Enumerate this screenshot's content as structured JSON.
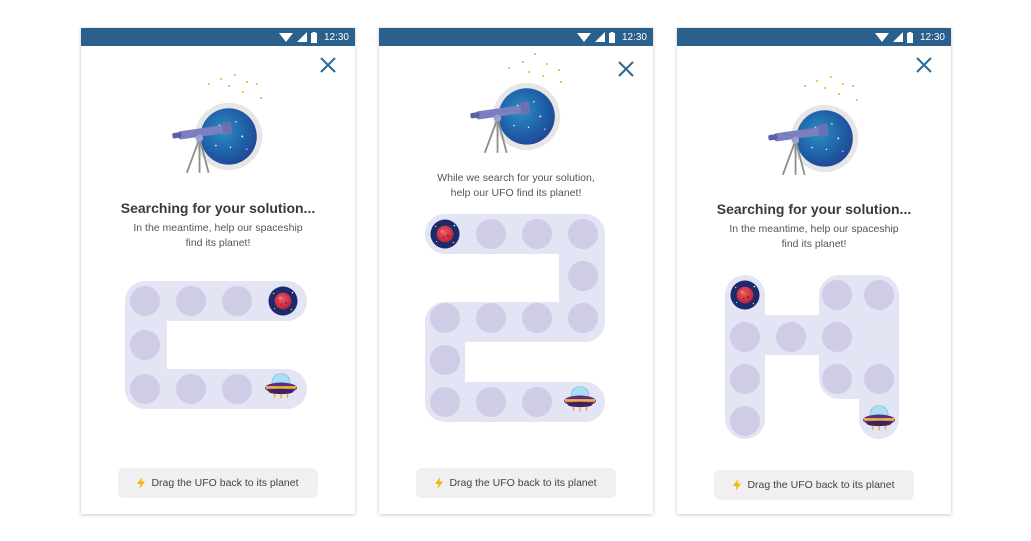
{
  "colors": {
    "status_bar": "#2b5f8c",
    "close_icon": "#2b6b96",
    "path_bg": "#e3e4f4",
    "cell": "#cfcde6",
    "hint_bg": "#f0f0f3",
    "bolt": "#f7b500",
    "planet_red": "#d7384a",
    "space_blue": "#1f5fa8"
  },
  "screens": [
    {
      "status_time": "12:30",
      "title": "Searching for your solution...",
      "subtitle_lines": [
        "In the meantime, help our spaceship",
        "find its planet!"
      ],
      "hint_label": "Drag the UFO back to its planet"
    },
    {
      "status_time": "12:30",
      "title": "",
      "subtitle_lines": [
        "While we search for your solution,",
        "help our UFO find its planet!"
      ],
      "hint_label": "Drag the UFO back to its planet"
    },
    {
      "status_time": "12:30",
      "title": "Searching for your solution...",
      "subtitle_lines": [
        "In the meantime, help our spaceship",
        "find its planet!"
      ],
      "hint_label": "Drag the UFO back to its planet"
    }
  ],
  "icons": {
    "close": "close-icon",
    "wifi": "wifi-icon",
    "signal": "signal-icon",
    "battery": "battery-icon",
    "bolt": "lightning-icon",
    "planet": "planet-icon",
    "ufo": "ufo-icon",
    "telescope": "telescope-icon"
  }
}
